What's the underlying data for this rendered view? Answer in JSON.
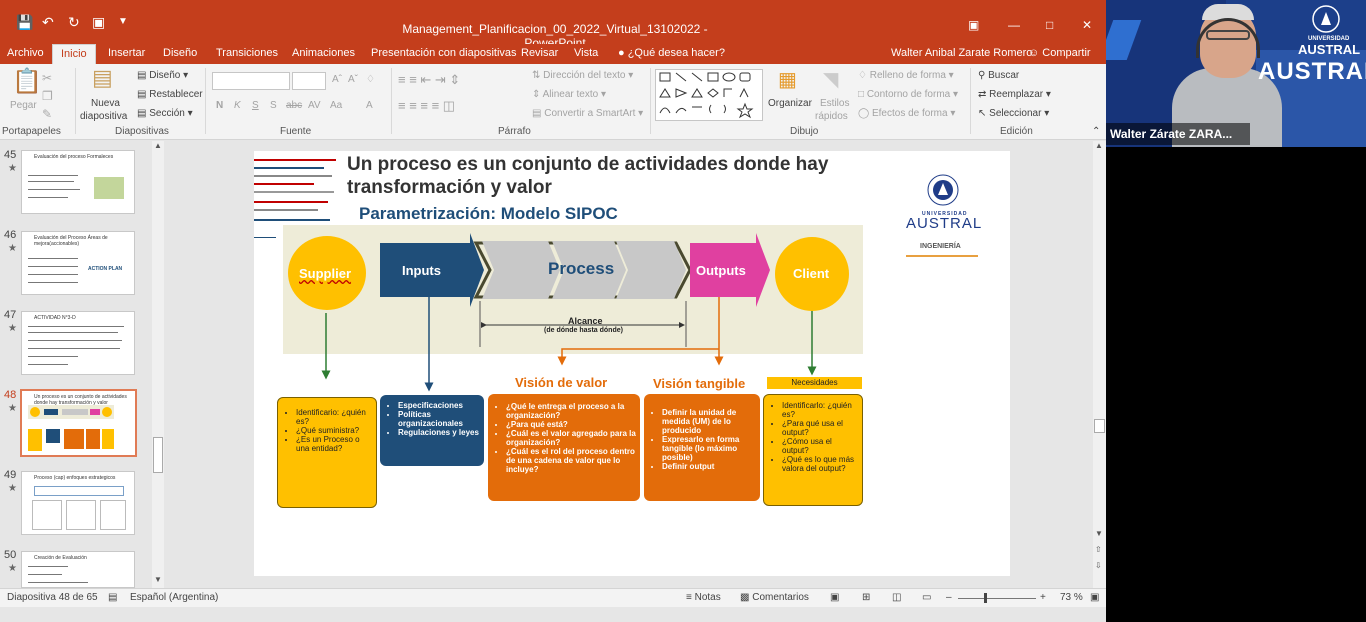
{
  "window": {
    "title": "Management_Planificacion_00_2022_Virtual_13102022 - PowerPoint"
  },
  "quick_access": {
    "save_icon": "save-icon",
    "undo_icon": "undo-icon",
    "redo_icon": "redo-icon",
    "present_icon": "start-presentation-icon"
  },
  "tabs": [
    "Archivo",
    "Inicio",
    "Insertar",
    "Diseño",
    "Transiciones",
    "Animaciones",
    "Presentación con diapositivas",
    "Revisar",
    "Vista",
    "¿Qué desea hacer?"
  ],
  "user": {
    "name": "Walter Anibal Zarate Romero",
    "share": "Compartir"
  },
  "ribbon": {
    "paste": "Pegar",
    "new_slide_1": "Nueva",
    "new_slide_2": "diapositiva",
    "layout": "Diseño",
    "reset": "Restablecer",
    "section": "Sección",
    "text_direction": "Dirección del texto",
    "align_text": "Alinear texto",
    "smartart": "Convertir a SmartArt",
    "arrange": "Organizar",
    "quick_styles_1": "Estilos",
    "quick_styles_2": "rápidos",
    "shape_fill": "Relleno de forma",
    "shape_outline": "Contorno de forma",
    "shape_effects": "Efectos de forma",
    "find": "Buscar",
    "replace": "Reemplazar",
    "select": "Seleccionar",
    "groups": [
      "Portapapeles",
      "Diapositivas",
      "Fuente",
      "Párrafo",
      "Dibujo",
      "Edición"
    ],
    "font_buttons": [
      "N",
      "K",
      "S",
      "S",
      "abc",
      "AV",
      "Aa",
      "A"
    ]
  },
  "thumbnails": [
    {
      "num": "45",
      "title": "Evaluación del proceso Formaleces"
    },
    {
      "num": "46",
      "title": "Evaluación del Proceso Áreas de mejora(accionables)",
      "badge": "ACTION PLAN"
    },
    {
      "num": "47",
      "title": "ACTIVIDAD N°3-D"
    },
    {
      "num": "48",
      "title": "Un proceso es un conjunto de actividades donde hay transformación y valor"
    },
    {
      "num": "49",
      "title": "Proceso (cap) enfoques estrategicos"
    },
    {
      "num": "50",
      "title": "Creación de Evaluación"
    }
  ],
  "slide": {
    "title_line1": "Un proceso es un conjunto de actividades donde hay",
    "title_line2": "transformación y valor",
    "subtitle": "Parametrización: Modelo SIPOC",
    "logo": {
      "name": "AUSTRAL",
      "small": "UNIVERSIDAD",
      "dept": "INGENIERÍA"
    },
    "sipoc": {
      "supplier": "Supplier",
      "inputs": "Inputs",
      "process": "Process",
      "outputs": "Outputs",
      "client": "Client"
    },
    "alcance": "Alcance",
    "alcance_sub": "(de dónde hasta dónde)",
    "vision_valor": "Visión de valor",
    "vision_tangible": "Visión tangible",
    "necesidades": "Necesidades",
    "box_supplier": [
      "Identificario: ¿quién es?",
      "¿Qué suministra?",
      "¿Es un Proceso o una entidad?"
    ],
    "box_inputs": [
      "Especificaciones",
      "Políticas organizacionales",
      "Regulaciones y leyes"
    ],
    "box_valor": [
      "¿Qué le entrega el proceso a la organización?",
      "¿Para qué está?",
      "¿Cuál es el valor agregado para la organización?",
      "¿Cuál es el rol del proceso dentro de una cadena de valor que lo incluye?"
    ],
    "box_tangible": [
      "Definir la unidad de medida (UM) de lo producido",
      "Expresarlo en forma tangible (lo máximo posible)",
      "Definir output"
    ],
    "box_client": [
      "Identificarlo: ¿quién es?",
      "¿Para qué usa el output?",
      "¿Cómo usa el output?",
      "¿Qué es lo que más valora del output?"
    ]
  },
  "status": {
    "slide": "Diapositiva 48 de 65",
    "language": "Español (Argentina)",
    "notes": "Notas",
    "comments": "Comentarios",
    "zoom": "73 %"
  },
  "video": {
    "name": "Walter Zárate ZARA...",
    "brand_small": "UNIVERSIDAD",
    "brand": "AUSTRAL"
  },
  "colors": {
    "ppt": "#c43e1c",
    "supplier": "#ffc000",
    "inputs": "#1f4e79",
    "outputs": "#e040a0",
    "valor": "#e36c0a"
  }
}
